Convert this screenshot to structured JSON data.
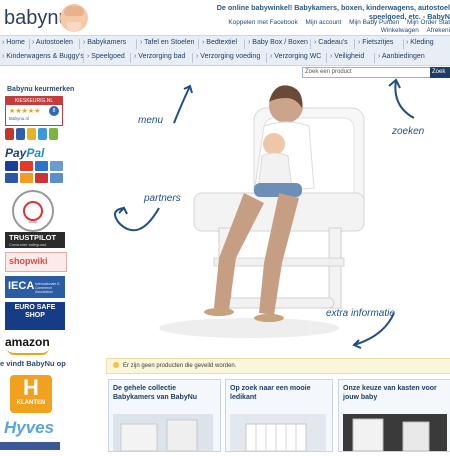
{
  "header": {
    "logo": "babynu",
    "tagline_line1": "De online babywinkel! Babykamers, boxen, kinderwagens, autostoel",
    "tagline_line2": "speelgoed, etc. - BabyN",
    "links": [
      "Koppelen met Facebook",
      "Mijn account",
      "Mijn Baby Punten",
      "Mijn Order Stat"
    ],
    "links2": [
      "Winkelwagen",
      "Afrekeni"
    ]
  },
  "nav": {
    "row1": [
      "Home",
      "Autostoelen",
      "Babykamers",
      "Tafel en Stoelen",
      "Bedtextiel",
      "Baby Box / Boxen",
      "Cadeau's",
      "Fietszitjes",
      "Kleding"
    ],
    "row2": [
      "Kinderwagens & Buggy's",
      "Speelgoed",
      "Verzorging bad",
      "Verzorging voeding",
      "Verzorging WC",
      "Veiligheid",
      "Aanbiedingen"
    ]
  },
  "search": {
    "placeholder": "Zoek een product",
    "button": "Zoek"
  },
  "sidebar": {
    "title": "Babynu keurmerken",
    "keur_title": "KIESKEURIG.NL",
    "keur_stars": "★★★★★",
    "keur_score": "8",
    "keur_site": "Babynu.nl",
    "paypal_a": "Pay",
    "paypal_b": "Pal",
    "seal_text": "shop",
    "trustpilot": "TRUSTPILOT",
    "trustpilot_sub": "Consumer safeguard",
    "shopwiki": "shopwiki",
    "ieca": "IECA",
    "ieca_sub": "Internationale E-Commerce Association",
    "eurosafe": "EURO SAFE SHOP",
    "amazon": "amazon",
    "vind": "e vindt BabyNu op",
    "hyves_h": "H",
    "hyves_klanten": "KLANTEN",
    "hyves": "Hyves"
  },
  "hero": {
    "annot_menu": "menu",
    "annot_zoeken": "zoeken",
    "annot_partners": "partners",
    "annot_extra": "extra informatie"
  },
  "notice": {
    "text": "Er zijn geen producten die geveild worden."
  },
  "cards": [
    {
      "title_l1": "De gehele collectie",
      "title_l2": "Babykamers van BabyNu"
    },
    {
      "title_l1": "Op zoek naar een mooie",
      "title_l2": "ledikant"
    },
    {
      "title_l1": "Onze keuze van kasten voor",
      "title_l2": "jouw baby"
    }
  ],
  "colors": {
    "brand": "#1f3e66",
    "accent": "#1f4f82",
    "nav_bg": "#e8eef5",
    "notice_bg": "#fbf6d9"
  }
}
